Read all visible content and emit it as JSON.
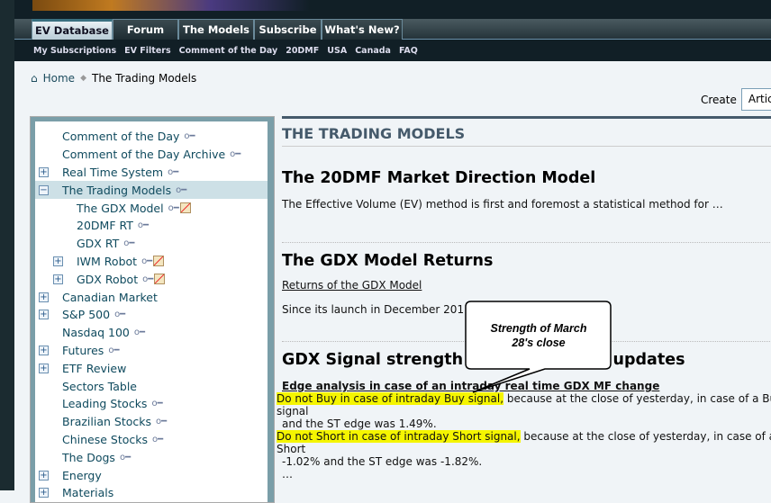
{
  "nav": {
    "tabs": [
      "EV Database",
      "Forum",
      "The Models",
      "Subscribe",
      "What's New?"
    ],
    "subnav": [
      "My Subscriptions",
      "EV Filters",
      "Comment of the Day",
      "20DMF",
      "USA",
      "Canada",
      "FAQ"
    ]
  },
  "breadcrumb": {
    "home": "Home",
    "current": "The Trading Models"
  },
  "create": {
    "label": "Create",
    "value": "Article"
  },
  "sidebar": {
    "items": [
      {
        "label": "Comment of the Day",
        "level": 0,
        "expander": "",
        "key": true,
        "book": false
      },
      {
        "label": "Comment of the Day Archive",
        "level": 0,
        "expander": "",
        "key": true,
        "book": false
      },
      {
        "label": "Real Time System",
        "level": 0,
        "expander": "plus",
        "key": true,
        "book": false
      },
      {
        "label": "The Trading Models",
        "level": 0,
        "expander": "minus",
        "key": true,
        "book": false,
        "selected": true
      },
      {
        "label": "The GDX Model",
        "level": 1,
        "expander": "",
        "key": true,
        "book": true
      },
      {
        "label": "20DMF RT",
        "level": 1,
        "expander": "",
        "key": true,
        "book": false
      },
      {
        "label": "GDX RT",
        "level": 1,
        "expander": "",
        "key": true,
        "book": false
      },
      {
        "label": "IWM Robot",
        "level": 1,
        "expander": "plus",
        "key": true,
        "book": true
      },
      {
        "label": "GDX Robot",
        "level": 1,
        "expander": "plus",
        "key": true,
        "book": true
      },
      {
        "label": "Canadian Market",
        "level": 0,
        "expander": "plus",
        "key": false,
        "book": false
      },
      {
        "label": "S&P 500",
        "level": 0,
        "expander": "plus",
        "key": true,
        "book": false
      },
      {
        "label": "Nasdaq 100",
        "level": 0,
        "expander": "",
        "key": true,
        "book": false
      },
      {
        "label": "Futures",
        "level": 0,
        "expander": "plus",
        "key": true,
        "book": false
      },
      {
        "label": "ETF Review",
        "level": 0,
        "expander": "plus",
        "key": false,
        "book": false
      },
      {
        "label": "Sectors Table",
        "level": 0,
        "expander": "",
        "key": false,
        "book": false
      },
      {
        "label": "Leading Stocks",
        "level": 0,
        "expander": "",
        "key": true,
        "book": false
      },
      {
        "label": "Brazilian Stocks",
        "level": 0,
        "expander": "",
        "key": true,
        "book": false
      },
      {
        "label": "Chinese Stocks",
        "level": 0,
        "expander": "",
        "key": true,
        "book": false
      },
      {
        "label": "The Dogs",
        "level": 0,
        "expander": "",
        "key": true,
        "book": false
      },
      {
        "label": "Energy",
        "level": 0,
        "expander": "plus",
        "key": false,
        "book": false
      },
      {
        "label": "Materials",
        "level": 0,
        "expander": "plus",
        "key": false,
        "book": false
      }
    ]
  },
  "main": {
    "title": "THE TRADING MODELS",
    "s1": {
      "heading": "The 20DMF Market Direction Model",
      "text": "The Effective Volume (EV) method is first and foremost a statistical method for …"
    },
    "s2": {
      "heading": "The GDX Model Returns",
      "link": "Returns of the GDX Model",
      "text": "Since its launch in December 2011, as of"
    },
    "s3": {
      "heading": "GDX Signal strength levels and daily updates",
      "subheading": "Edge analysis in case of an intraday real time GDX MF change",
      "p1_hl": "Do not Buy in case of intraday Buy signal,",
      "p1": " because at the close of yesterday, in case of a Buy signal",
      "p1b": "and the ST edge was 1.49%.",
      "p2_hl": "Do not Short in case of intraday Short signal,",
      "p2": " because at the close of yesterday, in case of a Short",
      "p2b": "-1.02% and the ST edge was -1.82%.",
      "more": "…"
    }
  },
  "callout": {
    "text": "Strength of March 28's close"
  },
  "colors": {
    "highlight": "#f5f500",
    "link": "#0f4a5e",
    "header": "#111f26"
  }
}
